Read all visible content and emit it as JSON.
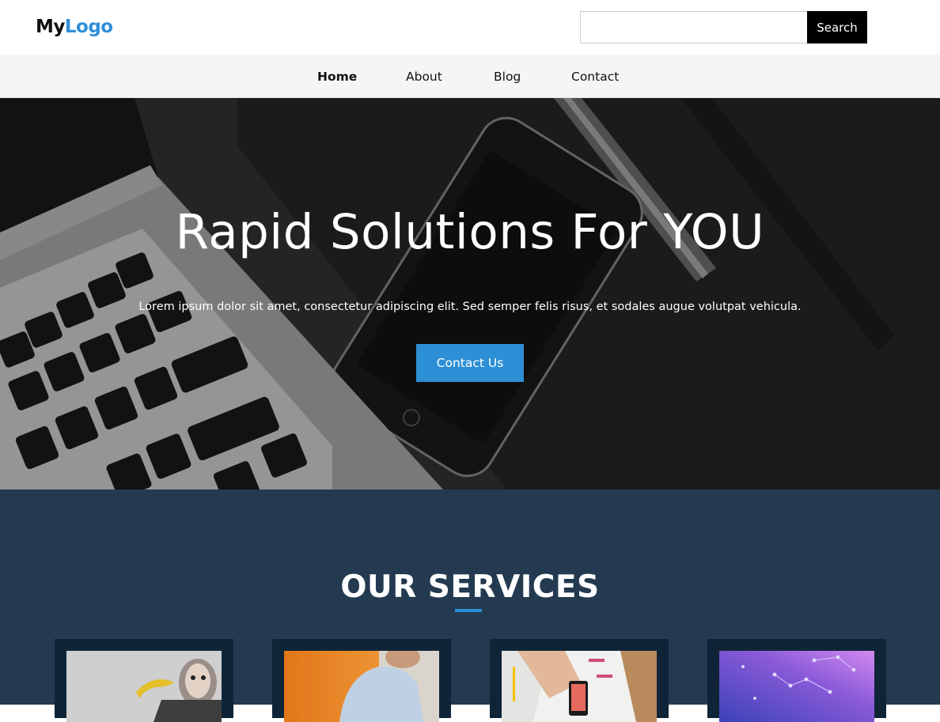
{
  "header": {
    "logo": {
      "part1": "My",
      "part2": "Logo"
    },
    "search": {
      "placeholder": "",
      "button_label": "Search"
    }
  },
  "nav": {
    "items": [
      {
        "label": "Home",
        "active": true
      },
      {
        "label": "About",
        "active": false
      },
      {
        "label": "Blog",
        "active": false
      },
      {
        "label": "Contact",
        "active": false
      }
    ]
  },
  "hero": {
    "title": "Rapid Solutions For YOU",
    "text": "Lorem ipsum dolor sit amet, consectetur adipiscing elit. Sed semper felis risus, et sodales augue volutpat vehicula.",
    "button_label": "Contact Us"
  },
  "services": {
    "title": "OUR SERVICES",
    "cards": [
      {
        "image": "person-with-banana-photo"
      },
      {
        "image": "man-in-blue-shirt-photo"
      },
      {
        "image": "desk-with-phone-and-papers-photo"
      },
      {
        "image": "purple-network-graphic"
      }
    ]
  },
  "colors": {
    "accent": "#2d8fd5",
    "logo_accent": "#2f8fd8",
    "nav_background": "#f5f5f5",
    "services_background": "#233a50",
    "card_background": "#0f2537"
  }
}
